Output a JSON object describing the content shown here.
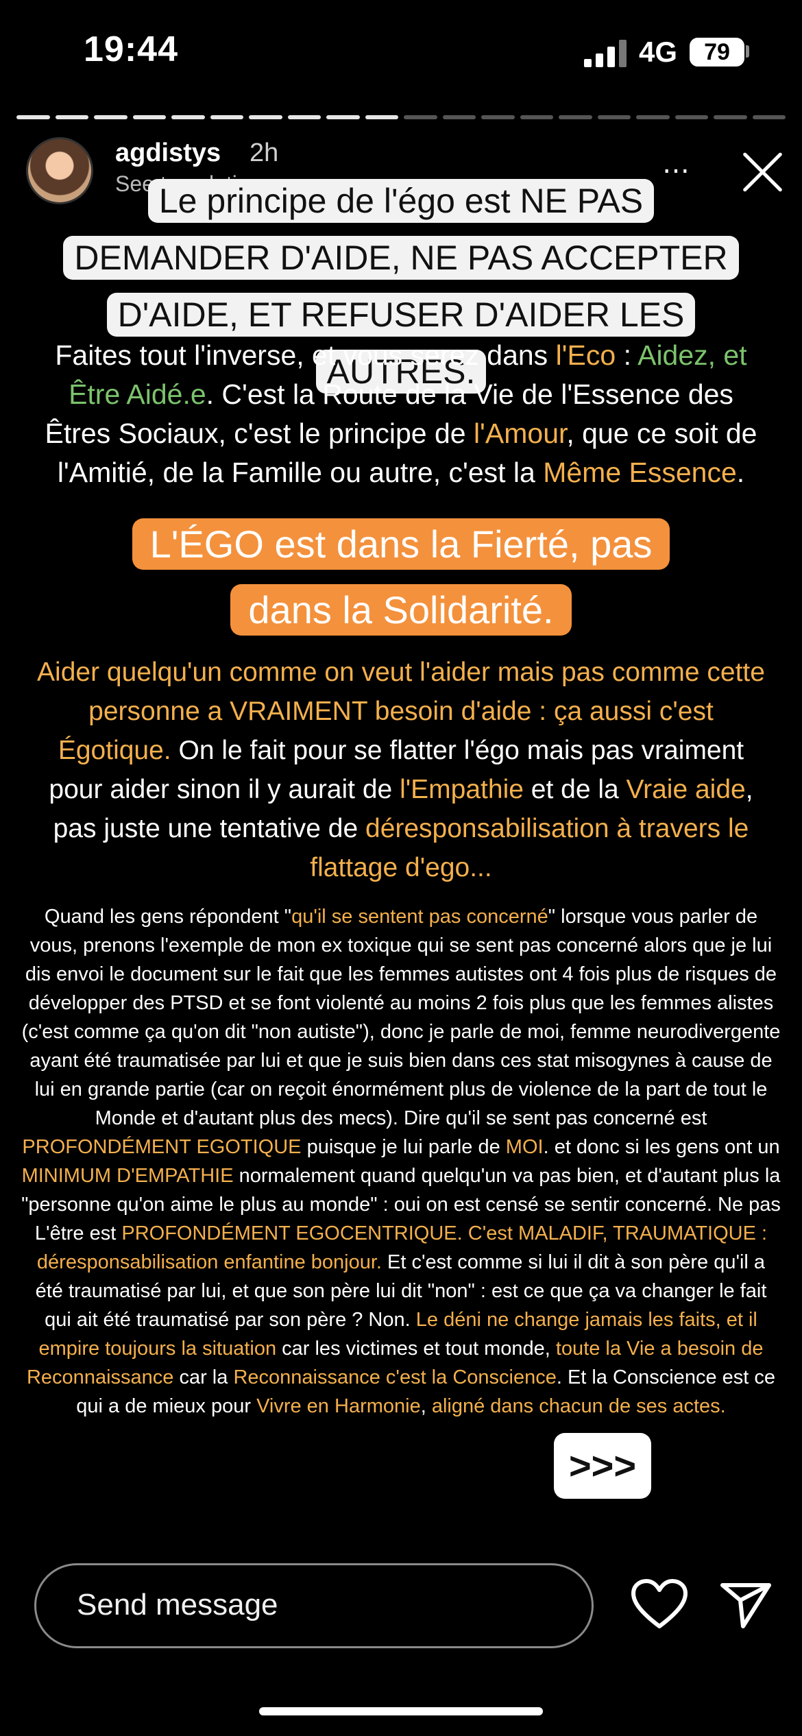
{
  "status_bar": {
    "time": "19:44",
    "network": "4G",
    "battery": "79"
  },
  "story": {
    "segments_total": 20,
    "segments_done": 10,
    "username": "agdistys",
    "time_ago": "2h",
    "see_translation": "See translation",
    "more_icon": "⋯",
    "close_icon": "close-icon"
  },
  "content": {
    "block1": "Le principe de l'égo est NE PAS DEMANDER D'AIDE, NE PAS ACCEPTER D'AIDE, ET REFUSER D'AIDER LES AUTRES.",
    "block2": [
      {
        "t": "Faites tout l'inverse, et vous serez dans ",
        "c": ""
      },
      {
        "t": "l'Eco",
        "c": "o"
      },
      {
        "t": " : ",
        "c": ""
      },
      {
        "t": "Aidez, et Être Aidé.e",
        "c": "g"
      },
      {
        "t": ". C'est la Route de la Vie de l'Essence des Êtres Sociaux, c'est le principe de ",
        "c": ""
      },
      {
        "t": "l'Amour",
        "c": "o"
      },
      {
        "t": ", que ce soit de l'Amitié, de la Famille ou autre, c'est la ",
        "c": ""
      },
      {
        "t": "Même Essence",
        "c": "o"
      },
      {
        "t": ".",
        "c": ""
      }
    ],
    "block3": "L'ÉGO est dans la Fierté, pas dans la Solidarité.",
    "block4": [
      {
        "t": "Aider quelqu'un comme on veut l'aider mais pas comme cette personne a VRAIMENT besoin d'aide : ça aussi c'est Égotique.",
        "c": "o"
      },
      {
        "t": " On le fait pour se flatter l'égo mais pas vraiment pour aider sinon il y aurait de ",
        "c": ""
      },
      {
        "t": "l'Empathie",
        "c": "o"
      },
      {
        "t": " et de la ",
        "c": ""
      },
      {
        "t": "Vraie aide",
        "c": "o"
      },
      {
        "t": ", pas juste une tentative de ",
        "c": ""
      },
      {
        "t": "déresponsabilisation à travers le flattage d'ego...",
        "c": "o"
      }
    ],
    "block5": [
      {
        "t": "Quand les gens répondent \"",
        "c": ""
      },
      {
        "t": "qu'il se sentent pas concerné",
        "c": "o"
      },
      {
        "t": "\" lorsque vous parler de vous, prenons l'exemple de mon ex toxique qui se sent pas concerné alors que je lui dis envoi le document sur le fait que les femmes autistes ont 4 fois plus de risques de développer des PTSD et se font violenté au moins 2 fois plus que les femmes alistes (c'est comme ça qu'on dit \"non autiste\"), donc je parle de moi, femme neurodivergente ayant été traumatisée par lui et que je suis bien dans ces stat misogynes à cause de lui en grande partie (car on reçoit énormément plus de violence de la part de tout le Monde et d'autant plus des mecs). Dire qu'il se sent pas concerné est ",
        "c": ""
      },
      {
        "t": "PROFONDÉMENT EGOTIQUE",
        "c": "o"
      },
      {
        "t": " puisque je lui parle de ",
        "c": ""
      },
      {
        "t": "MOI",
        "c": "o"
      },
      {
        "t": ". et donc si les gens ont un ",
        "c": ""
      },
      {
        "t": "MINIMUM D'EMPATHIE",
        "c": "o"
      },
      {
        "t": " normalement quand quelqu'un va pas bien, et d'autant plus la \"personne qu'on aime le plus au monde\" : oui on est censé se sentir concerné. Ne pas L'être est ",
        "c": ""
      },
      {
        "t": "PROFONDÉMENT EGOCENTRIQUE.",
        "c": "o"
      },
      {
        "t": " ",
        "c": ""
      },
      {
        "t": "C'est MALADIF, TRAUMATIQUE : déresponsabilisation enfantine bonjour.",
        "c": "o"
      },
      {
        "t": " Et c'est comme si lui il dit à son père qu'il a été traumatisé par lui, et que son père lui dit \"non\" : est ce que ça va changer le fait qui ait été traumatisé par son père ? Non. ",
        "c": ""
      },
      {
        "t": "Le déni ne change jamais les faits, et il empire toujours la situation",
        "c": "o"
      },
      {
        "t": " car les victimes et tout monde, ",
        "c": ""
      },
      {
        "t": "toute la Vie a besoin de Reconnaissance",
        "c": "o"
      },
      {
        "t": " car la ",
        "c": ""
      },
      {
        "t": "Reconnaissance c'est la Conscience",
        "c": "o"
      },
      {
        "t": ". Et la Conscience est ce qui a de mieux pour ",
        "c": ""
      },
      {
        "t": "Vivre en Harmonie",
        "c": "o"
      },
      {
        "t": ", ",
        "c": ""
      },
      {
        "t": "aligné dans chacun de ses actes.",
        "c": "o"
      }
    ],
    "next_button": ">>>"
  },
  "footer": {
    "message_placeholder": "Send message",
    "like_icon": "heart-icon",
    "share_icon": "send-icon"
  },
  "colors": {
    "accent_orange": "#f4913c",
    "text_orange": "#f4b04d",
    "text_green": "#7cc36d"
  }
}
